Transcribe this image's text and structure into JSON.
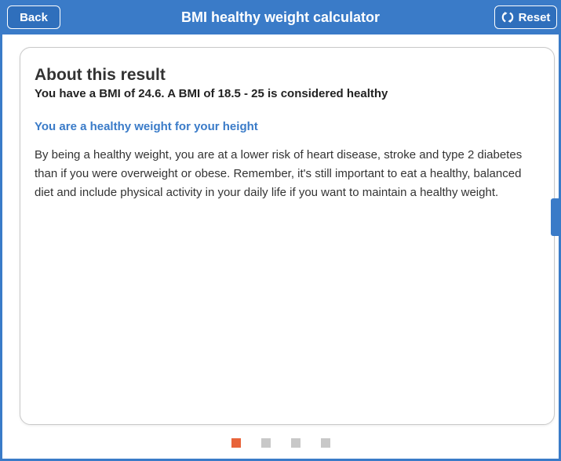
{
  "header": {
    "title": "BMI healthy weight calculator",
    "back_label": "Back",
    "reset_label": "Reset"
  },
  "result": {
    "heading": "About this result",
    "summary": "You have a BMI of 24.6. A BMI of 18.5 - 25 is considered healthy",
    "status": "You are a healthy weight for your height",
    "description": "By being a healthy weight, you are at a lower risk of heart disease, stroke and type 2 diabetes than if you were overweight or obese. Remember, it's still important to eat a healthy, balanced diet and include physical activity in your daily life if you want to maintain a healthy weight."
  },
  "pager": {
    "total_pages": 4,
    "current_page": 1
  },
  "colors": {
    "brand_blue": "#3a7bc8",
    "active_dot": "#e8643a",
    "inactive_dot": "#c8c8c8"
  },
  "icons": {
    "reset": "refresh-icon"
  }
}
